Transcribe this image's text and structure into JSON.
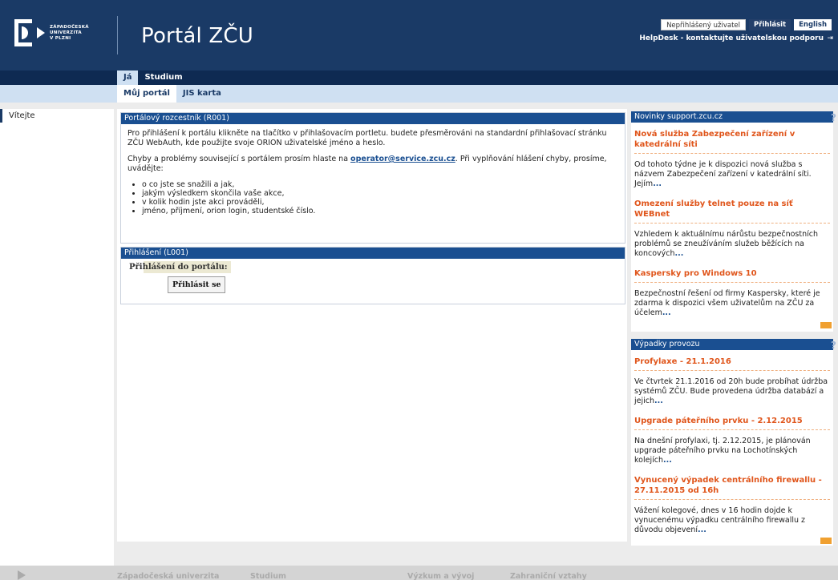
{
  "header": {
    "logo_lines": [
      "ZÁPADOČESKÁ",
      "UNIVERZITA",
      "V PLZNI"
    ],
    "title": "Portál ZČU",
    "status": "Nepřihlášený uživatel",
    "login": "Přihlásit",
    "language": "English",
    "helpdesk": "HelpDesk - kontaktujte uživatelskou podporu",
    "logout_icon": "⇥"
  },
  "nav1": {
    "tabs": [
      {
        "label": "Já"
      },
      {
        "label": "Studium"
      }
    ]
  },
  "nav2": {
    "tabs": [
      {
        "label": "Můj portál"
      },
      {
        "label": "JIS karta"
      }
    ]
  },
  "sidebar": {
    "items": [
      {
        "label": "Vítejte"
      }
    ]
  },
  "rozcestnik": {
    "title": "Portálový rozcestník (R001)",
    "p1": "Pro přihlášení k portálu klikněte na tlačítko v přihlašovacím portletu. budete přesměrováni na standardní přihlašovací stránku ZČU WebAuth, kde použijte svoje ORION uživatelské jméno a heslo.",
    "p2_before": "Chyby a problémy související s portálem prosím hlaste na ",
    "p2_link": "operator@service.zcu.cz",
    "p2_after": ". Při vyplňování hlášení chyby, prosíme, uvádějte:",
    "bullets": [
      "o co jste se snažili a jak,",
      "jakým výsledkem skončila vaše akce,",
      "v kolik hodin jste akci prováděli,",
      "jméno, příjmení, orion login, studentské číslo."
    ]
  },
  "login_portlet": {
    "title": "Přihlášení (L001)",
    "label": "Přihlášení do portálu:",
    "button": "Přihlásit se"
  },
  "novinky": {
    "title": "Novinky support.zcu.cz",
    "help": "?",
    "items": [
      {
        "title": "Nová služba Zabezpečení zařízení v katedrální síti",
        "text": "Od tohoto týdne je k dispozici nová služba s názvem Zabezpečení zařízení v katedrální síti. Jejím",
        "more": "..."
      },
      {
        "title": "Omezení služby telnet pouze na síť WEBnet",
        "text": "Vzhledem k aktuálnímu nárůstu bezpečnostních problémů se zneužíváním služeb běžících na koncových",
        "more": "..."
      },
      {
        "title": "Kaspersky pro Windows 10",
        "text": "Bezpečnostní řešení od firmy Kaspersky, které je zdarma k dispozici všem uživatelům na ZČU za účelem",
        "more": "..."
      }
    ]
  },
  "vypadky": {
    "title": "Výpadky provozu",
    "help": "?",
    "items": [
      {
        "title": "Profylaxe - 21.1.2016",
        "text": "Ve čtvrtek 21.1.2016 od 20h bude probíhat údržba systémů ZČU. Bude provedena údržba databází a jejich",
        "more": "..."
      },
      {
        "title": "Upgrade páteřního prvku - 2.12.2015",
        "text": "Na dnešní profylaxi, tj. 2.12.2015, je plánován upgrade páteřního prvku na Lochotínských kolejích",
        "more": "..."
      },
      {
        "title": "Vynucený výpadek centrálního firewallu - 27.11.2015 od 16h",
        "text": "Vážení kolegové, dnes v 16 hodin dojde k vynucenému výpadku centrálního firewallu z důvodu objevení",
        "more": "..."
      }
    ]
  },
  "footer": {
    "links": [
      {
        "label": "Západočeská univerzita"
      },
      {
        "label": "Studium"
      },
      {
        "label": "Výzkum a vývoj"
      },
      {
        "label": "Zahraniční vztahy"
      }
    ]
  },
  "colors": {
    "header": "#1a3a66",
    "nav": "#0e2a52",
    "subnav": "#cfe0f2",
    "portlet_head": "#1a4f91",
    "accent": "#e0561c"
  }
}
